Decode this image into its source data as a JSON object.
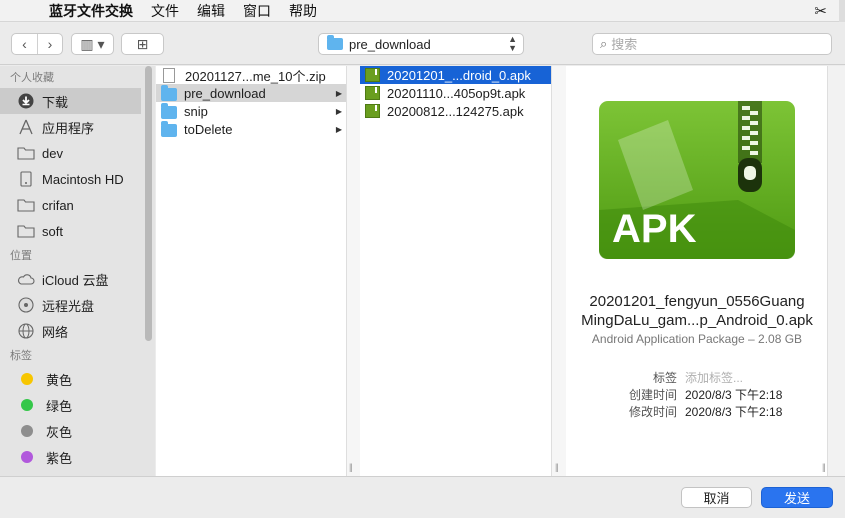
{
  "menubar": {
    "apple": "",
    "app_name": "蓝牙文件交换",
    "items": [
      "文件",
      "编辑",
      "窗口",
      "帮助"
    ]
  },
  "toolbar": {
    "back_glyph": "‹",
    "forward_glyph": "›",
    "view_glyph": "▥ ▾",
    "new_folder_glyph": "⊞",
    "path": "pre_download",
    "search_placeholder": "搜索"
  },
  "sidebar": {
    "favorites_header": "个人收藏",
    "favorites": [
      {
        "label": "下载",
        "icon": "download-icon",
        "selected": true
      },
      {
        "label": "应用程序",
        "icon": "applications-icon"
      },
      {
        "label": "dev",
        "icon": "folder-icon"
      },
      {
        "label": "Macintosh HD",
        "icon": "disk-icon"
      },
      {
        "label": "crifan",
        "icon": "folder-icon"
      },
      {
        "label": "soft",
        "icon": "folder-icon"
      }
    ],
    "locations_header": "位置",
    "locations": [
      {
        "label": "iCloud 云盘",
        "icon": "cloud-icon"
      },
      {
        "label": "远程光盘",
        "icon": "disc-icon"
      },
      {
        "label": "网络",
        "icon": "network-icon"
      }
    ],
    "tags_header": "标签",
    "tags": [
      {
        "label": "黄色",
        "color": "#f7c600"
      },
      {
        "label": "绿色",
        "color": "#34c749"
      },
      {
        "label": "灰色",
        "color": "#8e8e8e"
      },
      {
        "label": "紫色",
        "color": "#b159dc"
      }
    ]
  },
  "column1": [
    {
      "label": "20201127...me_10个.zip",
      "type": "zip"
    },
    {
      "label": "pre_download",
      "type": "folder",
      "highlighted": true
    },
    {
      "label": "snip",
      "type": "folder"
    },
    {
      "label": "toDelete",
      "type": "folder"
    }
  ],
  "column2": [
    {
      "label": "20201201_...droid_0.apk",
      "selected": true
    },
    {
      "label": "20201110...405op9t.apk"
    },
    {
      "label": "20200812...124275.apk"
    }
  ],
  "preview": {
    "icon_text": "APK",
    "name_line1": "20201201_fengyun_0556Guang",
    "name_line2": "MingDaLu_gam...p_Android_0.apk",
    "kind": "Android Application Package – 2.08 GB",
    "tags_label": "标签",
    "tags_placeholder": "添加标签...",
    "created_label": "创建时间",
    "created_value": "2020/8/3 下午2:18",
    "modified_label": "修改时间",
    "modified_value": "2020/8/3 下午2:18"
  },
  "footer": {
    "cancel": "取消",
    "send": "发送"
  }
}
